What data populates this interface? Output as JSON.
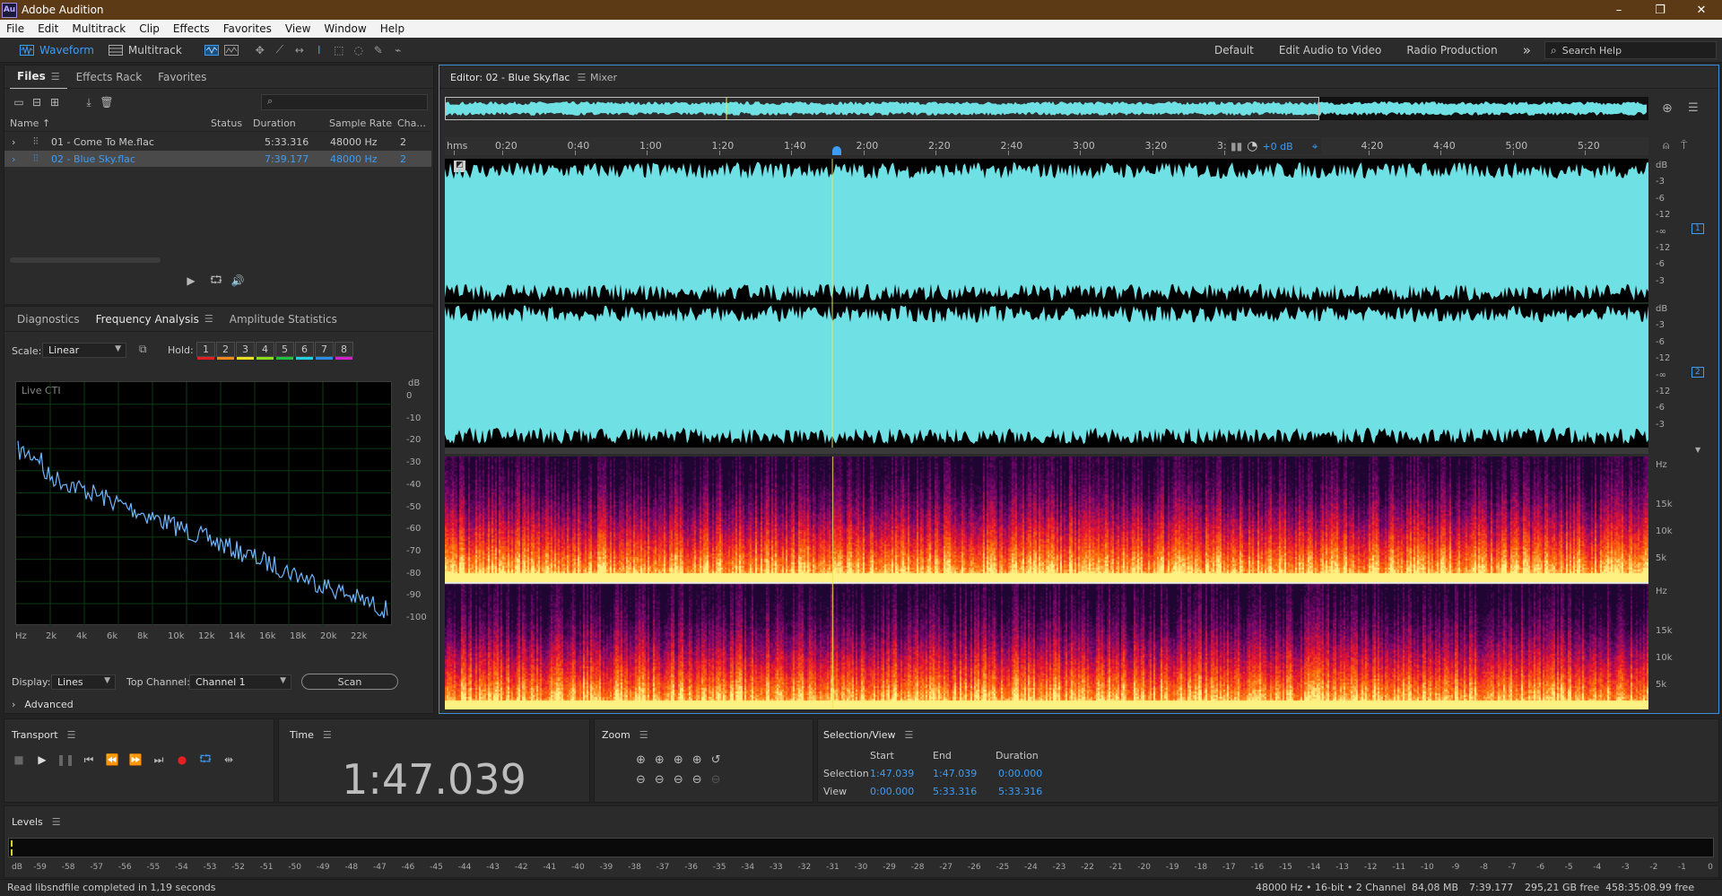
{
  "app": {
    "title": "Adobe Audition",
    "logo_text": "Au"
  },
  "window_controls": [
    "–",
    "❐",
    "✕"
  ],
  "menu": [
    "File",
    "Edit",
    "Multitrack",
    "Clip",
    "Effects",
    "Favorites",
    "View",
    "Window",
    "Help"
  ],
  "toolbar": {
    "waveform_label": "Waveform",
    "multitrack_label": "Multitrack"
  },
  "workspaces": [
    "Default",
    "Edit Audio to Video",
    "Radio Production"
  ],
  "more_workspaces": "»",
  "search": {
    "placeholder": "Search Help"
  },
  "files_panel": {
    "tabs": [
      "Files",
      "Effects Rack",
      "Favorites"
    ],
    "search_glyph": "⌕",
    "columns": {
      "name": "Name ↑",
      "status": "Status",
      "duration": "Duration",
      "sample_rate": "Sample Rate",
      "channels": "Cha..."
    },
    "files": [
      {
        "name": "01 - Come To Me.flac",
        "status": "",
        "duration": "5:33.316",
        "sample_rate": "48000 Hz",
        "channels": "2"
      },
      {
        "name": "02 - Blue Sky.flac",
        "status": "",
        "duration": "7:39.177",
        "sample_rate": "48000 Hz",
        "channels": "2"
      }
    ]
  },
  "analysis_panel": {
    "tabs": [
      "Diagnostics",
      "Frequency Analysis",
      "Amplitude Statistics"
    ],
    "scale_label": "Scale:",
    "scale_value": "Linear",
    "hold_label": "Hold:",
    "hold_buttons": [
      "1",
      "2",
      "3",
      "4",
      "5",
      "6",
      "7",
      "8"
    ],
    "hold_colors": [
      "#e02020",
      "#ee8a1a",
      "#e8e020",
      "#8adf1a",
      "#20c040",
      "#20d0e0",
      "#2a8ee6",
      "#d020d0"
    ],
    "live_cti": "Live CTI",
    "db_label": "dB",
    "db_ticks": [
      "0",
      "-10",
      "-20",
      "-30",
      "-40",
      "-50",
      "-60",
      "-70",
      "-80",
      "-90",
      "-100"
    ],
    "hz_ticks": [
      "Hz",
      "2k",
      "4k",
      "6k",
      "8k",
      "10k",
      "12k",
      "14k",
      "16k",
      "18k",
      "20k",
      "22k"
    ],
    "display_label": "Display:",
    "display_value": "Lines",
    "top_channel_label": "Top Channel:",
    "top_channel_value": "Channel 1",
    "scan_label": "Scan",
    "advanced_label": "Advanced"
  },
  "editor": {
    "tab_label": "Editor: 02 - Blue Sky.flac",
    "mixer_label": "Mixer",
    "time_ruler": [
      "hms",
      "0:20",
      "0:40",
      "1:00",
      "1:20",
      "1:40",
      "2:00",
      "2:20",
      "2:40",
      "3:00",
      "3:20",
      "3:",
      "4:20",
      "4:40",
      "5:00",
      "5:20"
    ],
    "hud_gain": "+0 dB",
    "amp_scale": [
      "dB",
      "-3",
      "-6",
      "-12",
      "-∞",
      "-12",
      "-6",
      "-3"
    ],
    "channel_1": "1",
    "channel_2": "2",
    "freq_scale": [
      "Hz",
      "15k",
      "10k",
      "5k"
    ],
    "waveform_color": "#6fe0e4",
    "playhead_color": "#e8e85a"
  },
  "transport": {
    "title": "Transport"
  },
  "time_panel": {
    "title": "Time",
    "value": "1:47.039"
  },
  "zoom_panel": {
    "title": "Zoom"
  },
  "selection_panel": {
    "title": "Selection/View",
    "headers": [
      "Start",
      "End",
      "Duration"
    ],
    "rows": [
      {
        "label": "Selection",
        "start": "1:47.039",
        "end": "1:47.039",
        "duration": "0:00.000"
      },
      {
        "label": "View",
        "start": "0:00.000",
        "end": "5:33.316",
        "duration": "5:33.316"
      }
    ]
  },
  "levels": {
    "title": "Levels",
    "scale": [
      "dB",
      "-59",
      "-58",
      "-57",
      "-56",
      "-55",
      "-54",
      "-53",
      "-52",
      "-51",
      "-50",
      "-49",
      "-48",
      "-47",
      "-46",
      "-45",
      "-44",
      "-43",
      "-42",
      "-41",
      "-40",
      "-39",
      "-38",
      "-37",
      "-36",
      "-35",
      "-34",
      "-33",
      "-32",
      "-31",
      "-30",
      "-29",
      "-28",
      "-27",
      "-26",
      "-25",
      "-24",
      "-23",
      "-22",
      "-21",
      "-20",
      "-19",
      "-18",
      "-17",
      "-16",
      "-15",
      "-14",
      "-13",
      "-12",
      "-11",
      "-10",
      "-9",
      "-8",
      "-7",
      "-6",
      "-5",
      "-4",
      "-3",
      "-2",
      "-1",
      "0"
    ]
  },
  "status_bar": {
    "message": "Read libsndfile completed in 1,19 seconds",
    "format": "48000 Hz • 16-bit • 2 Channel",
    "size": "84,08 MB",
    "duration": "7:39.177",
    "free_space": "295,21 GB free",
    "free_time": "458:35:08.99 free"
  }
}
